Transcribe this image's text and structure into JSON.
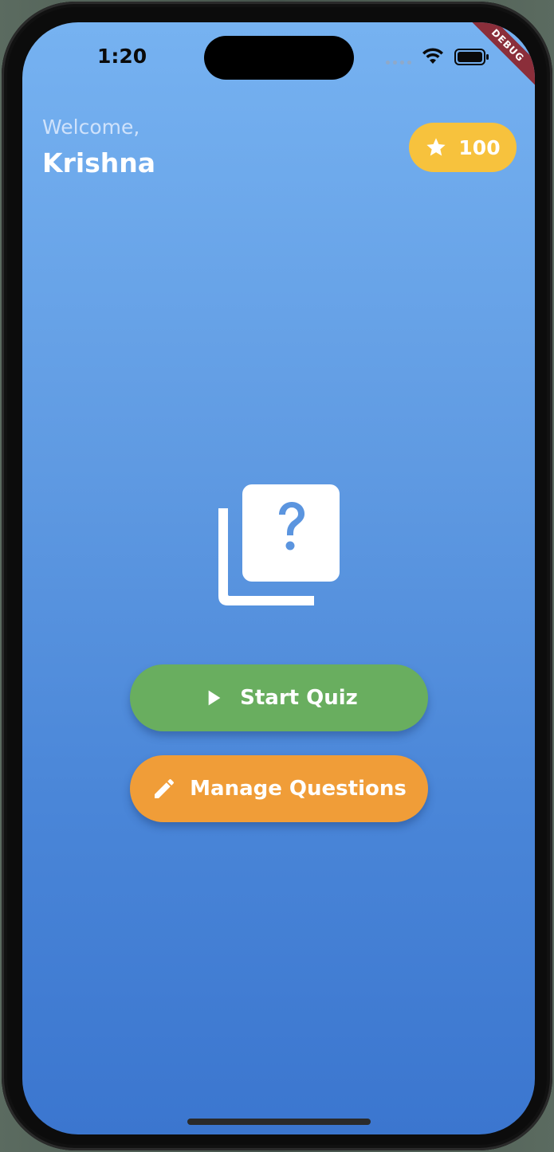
{
  "status_bar": {
    "time": "1:20"
  },
  "debug_banner": "DEBUG",
  "header": {
    "welcome": "Welcome,",
    "username": "Krishna"
  },
  "points": {
    "icon": "star-icon",
    "value": "100"
  },
  "logo": {
    "icon": "quiz-logo-icon"
  },
  "buttons": {
    "start": {
      "label": "Start Quiz",
      "icon": "play-icon"
    },
    "manage": {
      "label": "Manage Questions",
      "icon": "edit-icon"
    }
  },
  "colors": {
    "background_top": "#76b2f1",
    "background_bottom": "#3b76cf",
    "start_button": "#69ae5f",
    "manage_button": "#f09d38",
    "points_badge": "#f7c23d",
    "debug_banner": "#8b2e3a"
  }
}
